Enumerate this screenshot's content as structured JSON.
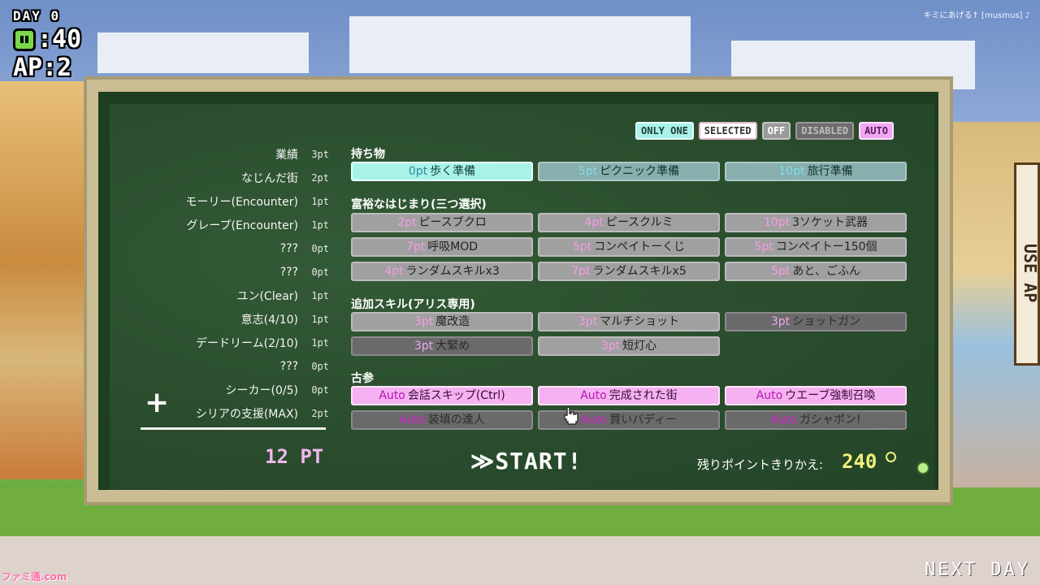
{
  "hud": {
    "day": "DAY 0",
    "hp": ":40",
    "ap": "AP:2"
  },
  "song": "キミにあげる↑ [musmus] ♪",
  "legend": {
    "only_one": "ONLY ONE",
    "selected": "SELECTED",
    "off": "OFF",
    "disabled": "DISABLED",
    "auto": "AUTO"
  },
  "scores": [
    {
      "name": "業績",
      "pt": "3pt"
    },
    {
      "name": "なじんだ街",
      "pt": "2pt"
    },
    {
      "name": "モーリー(Encounter)",
      "pt": "1pt"
    },
    {
      "name": "グレープ(Encounter)",
      "pt": "1pt"
    },
    {
      "name": "???",
      "pt": "0pt"
    },
    {
      "name": "???",
      "pt": "0pt"
    },
    {
      "name": "ユン(Clear)",
      "pt": "1pt"
    },
    {
      "name": "意志(4/10)",
      "pt": "1pt"
    },
    {
      "name": "デードリーム(2/10)",
      "pt": "1pt"
    },
    {
      "name": "???",
      "pt": "0pt"
    },
    {
      "name": "シーカー(0/5)",
      "pt": "0pt"
    },
    {
      "name": "シリアの支援(MAX)",
      "pt": "2pt"
    }
  ],
  "total": "12 PT",
  "sections": {
    "items": {
      "title": "持ち物",
      "buttons": [
        {
          "cost": "0pt",
          "label": "歩く準備"
        },
        {
          "cost": "5pt",
          "label": "ピクニック準備"
        },
        {
          "cost": "10pt",
          "label": "旅行準備"
        }
      ]
    },
    "rich": {
      "title": "富裕なはじまり(三つ選択)",
      "buttons": [
        {
          "cost": "2pt",
          "label": "ピースブクロ"
        },
        {
          "cost": "4pt",
          "label": "ピースクルミ"
        },
        {
          "cost": "10pt",
          "label": "3ソケット武器"
        },
        {
          "cost": "7pt",
          "label": "呼吸MOD"
        },
        {
          "cost": "5pt",
          "label": "コンペイトーくじ"
        },
        {
          "cost": "5pt",
          "label": "コンペイトー150個"
        },
        {
          "cost": "4pt",
          "label": "ランダムスキルx3"
        },
        {
          "cost": "7pt",
          "label": "ランダムスキルx5"
        },
        {
          "cost": "5pt",
          "label": "あと、ごふん"
        }
      ]
    },
    "skills": {
      "title": "追加スキル(アリス専用)",
      "buttons": [
        {
          "cost": "3pt",
          "label": "魔改造"
        },
        {
          "cost": "3pt",
          "label": "マルチショット"
        },
        {
          "cost": "3pt",
          "label": "ショットガン"
        },
        {
          "cost": "3pt",
          "label": "大緊め"
        },
        {
          "cost": "3pt",
          "label": "短灯心"
        }
      ]
    },
    "veteran": {
      "title": "古参",
      "buttons": [
        {
          "cost": "Auto",
          "label": "会話スキップ(Ctrl)"
        },
        {
          "cost": "Auto",
          "label": "完成された街"
        },
        {
          "cost": "Auto",
          "label": "ウエーブ強制召喚"
        },
        {
          "cost": "Auto",
          "label": "装填の達人"
        },
        {
          "cost": "Auto",
          "label": "買いバディー"
        },
        {
          "cost": "Auto",
          "label": "ガシャポン!"
        }
      ]
    }
  },
  "start": "≫START!",
  "remain_label": "残りポイントきりかえ:",
  "remain_value": "240",
  "sign_text": "USE AP",
  "next_day": "NEXT DAY",
  "logo": "ファミ通.com"
}
